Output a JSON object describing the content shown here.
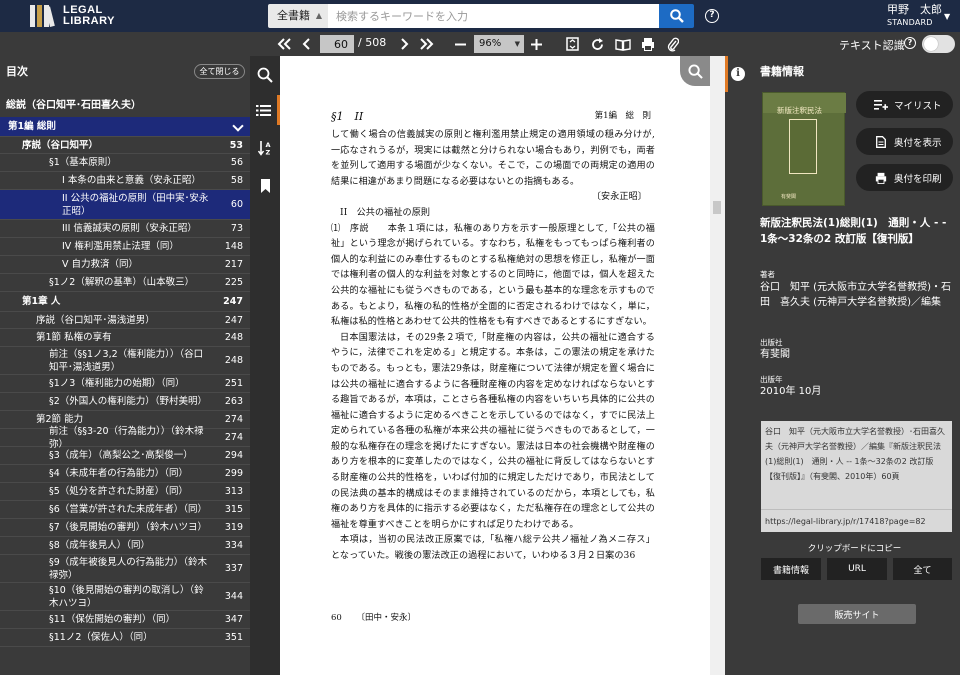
{
  "header": {
    "logo_line1": "LEGAL",
    "logo_line2": "LIBRARY",
    "search_category": "全書籍",
    "search_placeholder": "検索するキーワードを入力",
    "user_name": "甲野　太郎",
    "user_plan": "STANDARD"
  },
  "toolbar": {
    "current_page": "60",
    "total_pages": "/ 508",
    "zoom": "96%",
    "ocr_label": "テキスト認識"
  },
  "toc": {
    "title": "目次",
    "close_all": "全て閉じる",
    "root": "総説（谷口知平･石田喜久夫）",
    "items": [
      {
        "label": "第1編 総則",
        "page": ""
      },
      {
        "label": "序説（谷口知平）",
        "page": "53"
      },
      {
        "label": "§1（基本原則）",
        "page": "56"
      },
      {
        "label": "I 本条の由来と意義（安永正昭）",
        "page": "58"
      },
      {
        "label": "II 公共の福祉の原則（田中実･安永正昭）",
        "page": "60"
      },
      {
        "label": "III 信義誠実の原則（安永正昭）",
        "page": "73"
      },
      {
        "label": "IV 権利濫用禁止法理（同）",
        "page": "148"
      },
      {
        "label": "V 自力救済（同）",
        "page": "217"
      },
      {
        "label": "§1ノ2（解釈の基準）（山本敬三）",
        "page": "225"
      },
      {
        "label": "第1章 人",
        "page": "247"
      },
      {
        "label": "序説（谷口知平･湯浅道男）",
        "page": "247"
      },
      {
        "label": "第1節 私権の享有",
        "page": "248"
      },
      {
        "label": "前注（§§1ノ3,2（権利能力））（谷口知平･湯浅道男）",
        "page": "248"
      },
      {
        "label": "§1ノ3（権利能力の始期）（同）",
        "page": "251"
      },
      {
        "label": "§2（外国人の権利能力）（野村美明）",
        "page": "263"
      },
      {
        "label": "第2節 能力",
        "page": "274"
      },
      {
        "label": "前注（§§3-20（行為能力））（鈴木禄弥）",
        "page": "274"
      },
      {
        "label": "§3（成年）（高梨公之･高梨俊一）",
        "page": "294"
      },
      {
        "label": "§4（未成年者の行為能力）（同）",
        "page": "299"
      },
      {
        "label": "§5（処分を許された財産）（同）",
        "page": "313"
      },
      {
        "label": "§6（営業が許された未成年者）（同）",
        "page": "315"
      },
      {
        "label": "§7（後見開始の審判）（鈴木ハツヨ）",
        "page": "319"
      },
      {
        "label": "§8（成年後見人）（同）",
        "page": "334"
      },
      {
        "label": "§9（成年被後見人の行為能力）（鈴木禄弥）",
        "page": "337"
      },
      {
        "label": "§10（後見開始の審判の取消し）（鈴木ハツヨ）",
        "page": "344"
      },
      {
        "label": "§11（保佐開始の審判）（同）",
        "page": "347"
      },
      {
        "label": "§11ノ2（保佐人）（同）",
        "page": "351"
      }
    ]
  },
  "document": {
    "header_left": "§1　II",
    "header_right": "第1編　総　則",
    "paragraphs": [
      "して働く場合の信義誠実の原則と権利濫用禁止規定の適用領域の穏み分けが,一応なされうるが，現実には截然と分けられない場合もあり，判例でも，両者を並列して適用する場面が少なくない。そこで，この場面での両規定の適用の結果に相違があまり問題になる必要はないとの指摘もある。",
      "〔安永正昭〕",
      "II　公共の福祉の原則",
      "⑴　序説　　本条１項には，私権のあり方を示す一般原理として,「公共の福祉」という理念が掲げられている。すなわち，私権をもってもっぱら権利者の個人的な利益にのみ奉仕するものとする私権絶対の思想を修正し，私権が一面では権利者の個人的な利益を対象とするのと同時に，他面では，個人を超えた公共的な福祉にも従うべきものである，という最も基本的な理念を示すものである。もとより，私権の私的性格が全面的に否定されるわけではなく，単に，私権は私的性格とあわせて公共的性格をも有すべきであるとするにすぎない。",
      "日本国憲法は，その29条２項で,「財産権の内容は，公共の福祉に適合するやうに，法律でこれを定める」と規定する。本条は，この憲法の規定を承けたものである。もっとも，憲法29条は，財産権について法律が規定を置く場合には公共の福祉に適合するように各種財産権の内容を定めなければならないとする趣旨であるが，本項は，ことさら各種私権の内容をいちいち具体的に公共の福祉に適合するように定めるべきことを示しているのではなく，すでに民法上定められている各種の私権が本来公共の福祉に従うべきものであるとして，一般的な私権存在の理念を掲げたにすぎない。憲法は日本の社会機構や財産権のあり方を根本的に変革したのではなく，公共の福祉に背反してはならないとする財産権の公共的性格を，いわば付加的に規定しただけであり，市民法としての民法典の基本的構成はそのまま維持されているのだから，本項としても，私権のあり方を具体的に指示する必要はなく，ただ私権存在の理念として公共の福祉を尊重すべきことを明らかにすれば足りたわけである。",
      "本項は，当初の民法改正原案では,「私権ハ総テ公共ノ福祉ノ為メニ存ス」となっていた。戦後の憲法改正の過程において，いわゆる３月２日案の36"
    ],
    "footer_page": "60",
    "footer_author": "〔田中・安永〕"
  },
  "info": {
    "title": "書籍情報",
    "cover_title": "新版注釈民法",
    "cover_publisher": "有斐閣",
    "buttons": {
      "mylist": "マイリスト",
      "show_colophon": "奥付を表示",
      "print_colophon": "奥付を印刷"
    },
    "book_title": "新版注釈民法(1)総則(1)　通則・人 - - 1条〜32条の2 改訂版【復刊版】",
    "author_label": "著者",
    "author": "谷口　知平 (元大阪市立大学名誉教授)・石田　喜久夫 (元神戸大学名誉教授)／編集",
    "publisher_label": "出版社",
    "publisher": "有斐閣",
    "date_label": "出版年",
    "date": "2010年 10月",
    "citation": "谷口　知平（元大阪市立大学名誉教授）･石田喜久夫（元神戸大学名誉教授）／編集『新版注釈民法(1)総則(1)　通則・人 -- 1条〜32条の2 改訂版【復刊版】』（有斐閣、2010年）60頁",
    "url": "https://legal-library.jp/r/17418?page=82",
    "clipboard_label": "クリップボードにコピー",
    "copy_buttons": [
      "書籍情報",
      "URL",
      "全て"
    ],
    "shop_button": "販売サイト"
  },
  "colors": {
    "header_bg": "#1d2a44",
    "panel_bg": "#3a3a3a",
    "accent": "#e07a25",
    "selection": "#1d2a7a",
    "search_button": "#1d6bc4"
  }
}
